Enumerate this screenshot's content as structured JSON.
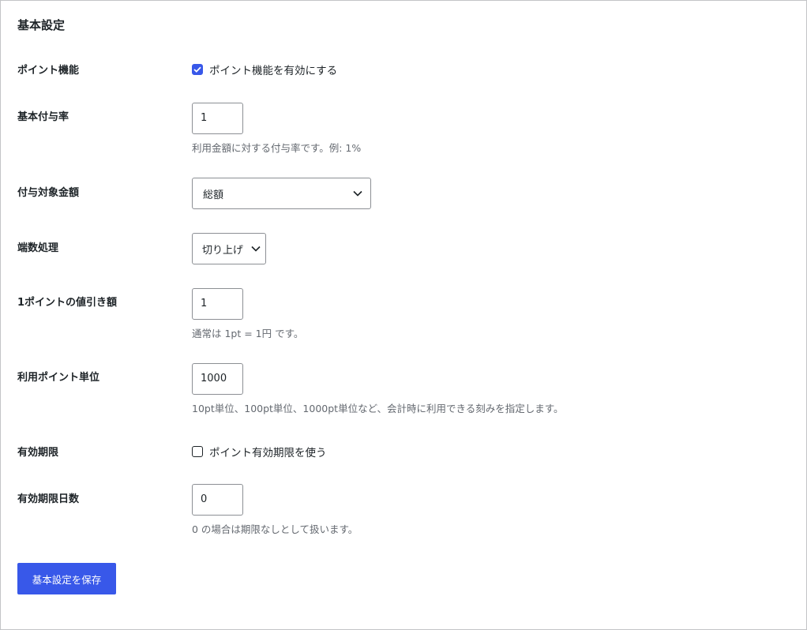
{
  "section": {
    "title": "基本設定"
  },
  "points_enabled": {
    "label": "ポイント機能",
    "checkbox_label": "ポイント機能を有効にする",
    "checked": true
  },
  "base_rate": {
    "label": "基本付与率",
    "value": "1",
    "description": "利用金額に対する付与率です。例: 1%"
  },
  "target_amount": {
    "label": "付与対象金額",
    "selected": "総額"
  },
  "rounding": {
    "label": "端数処理",
    "selected": "切り上げ"
  },
  "point_value": {
    "label": "1ポイントの値引き額",
    "value": "1",
    "description": "通常は 1pt = 1円 です。"
  },
  "usage_unit": {
    "label": "利用ポイント単位",
    "value": "1000",
    "description": "10pt単位、100pt単位、1000pt単位など、会計時に利用できる刻みを指定します。"
  },
  "expiry": {
    "label": "有効期限",
    "checkbox_label": "ポイント有効期限を使う",
    "checked": false
  },
  "expiry_days": {
    "label": "有効期限日数",
    "value": "0",
    "description": "0 の場合は期限なしとして扱います。"
  },
  "actions": {
    "save_label": "基本設定を保存"
  },
  "colors": {
    "accent": "#3858e9",
    "description_text": "#646970",
    "border": "#8c8f94"
  }
}
